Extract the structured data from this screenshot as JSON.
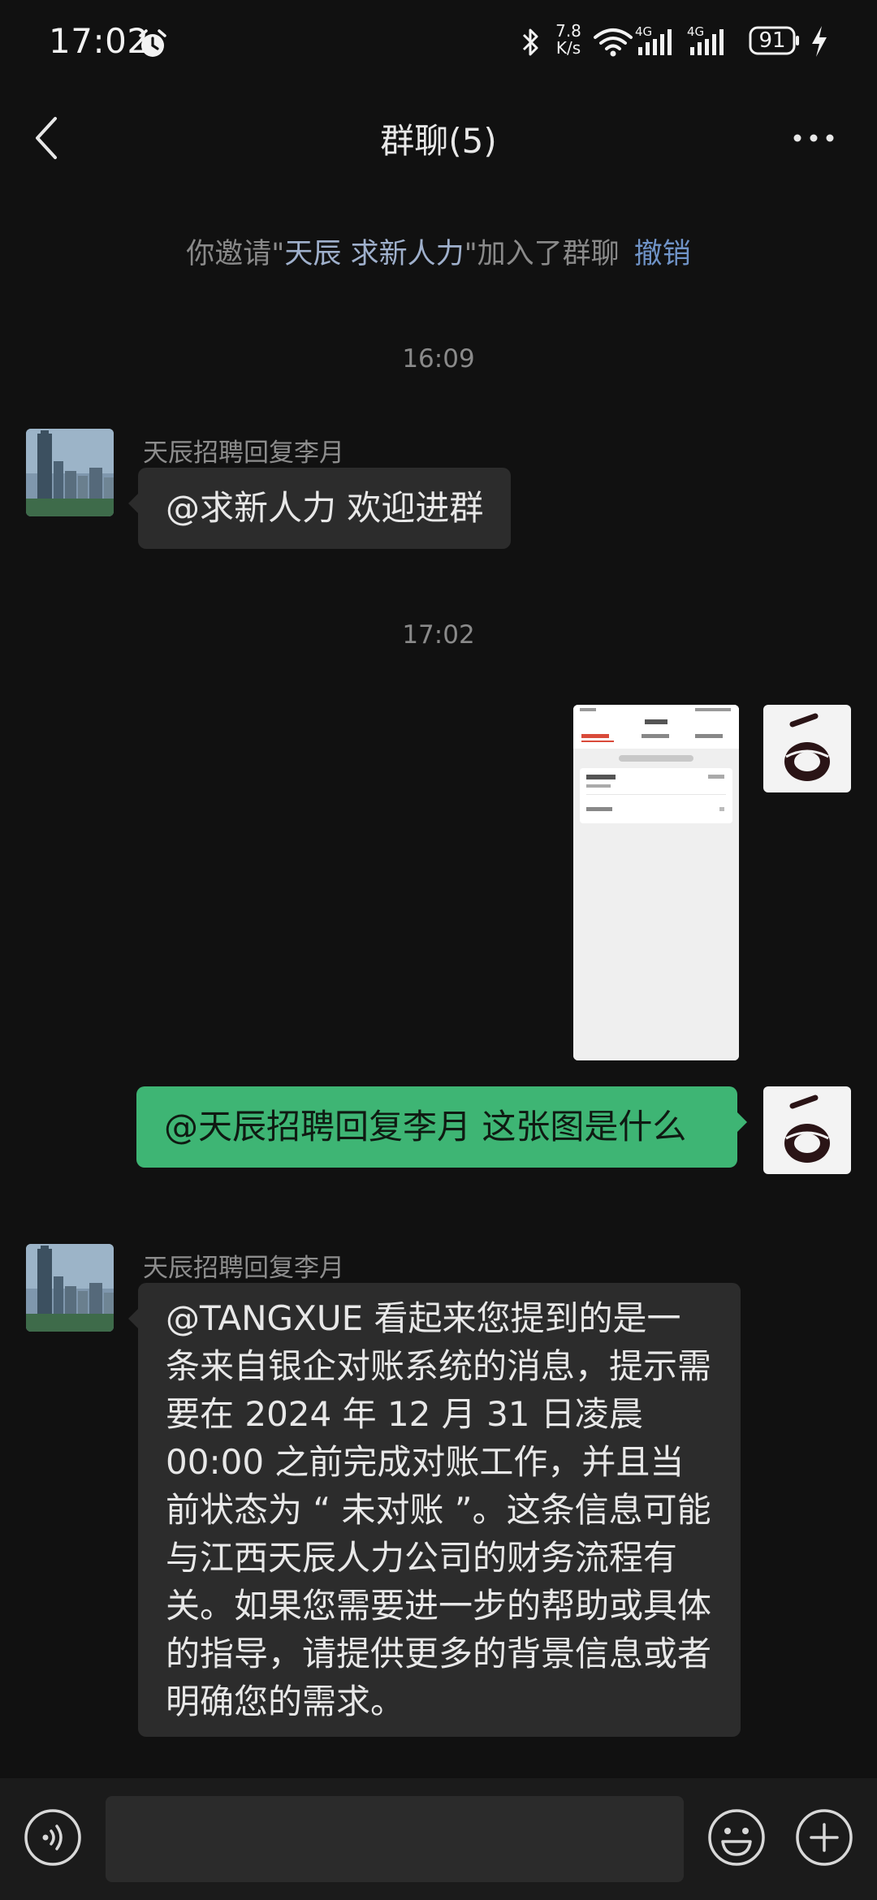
{
  "status_bar": {
    "time": "17:02",
    "net_speed_value": "7.8",
    "net_speed_unit": "K/s",
    "signal1_label": "4G",
    "signal2_label": "4G",
    "battery_level": "91"
  },
  "header": {
    "title": "群聊(5)"
  },
  "system_message": {
    "prefix": "你邀请\"",
    "inviter": "天辰",
    "invitee": "求新人力",
    "suffix": "\"加入了群聊",
    "undo_label": "撤销"
  },
  "messages": {
    "time1": "16:09",
    "msg1_sender": "天辰招聘回复李月",
    "msg1_text": "@求新人力 欢迎进群",
    "time2": "17:02",
    "msg3_text": "@天辰招聘回复李月  这张图是什么",
    "msg4_sender": "天辰招聘回复李月",
    "msg4_text": "@TANGXUE 看起来您提到的是一条来自银企对账系统的消息，提示需要在 2024 年 12 月 31 日凌晨 00:00 之前完成对账工作，并且当前状态为 “ 未对账 ”。这条信息可能与江西天辰人力公司的财务流程有关。如果您需要进一步的帮助或具体的指导，请提供更多的背景信息或者明确您的需求。"
  },
  "input_bar": {
    "placeholder": ""
  },
  "colors": {
    "background": "#111111",
    "bubble_in": "#2c2c2c",
    "bubble_out": "#3eb574",
    "link": "#6f93c7"
  },
  "icons": [
    "alarm-icon",
    "bluetooth-icon",
    "wifi-icon",
    "signal-icon",
    "battery-icon",
    "charge-icon",
    "back-icon",
    "more-icon",
    "voice-icon",
    "emoji-icon",
    "plus-icon"
  ]
}
